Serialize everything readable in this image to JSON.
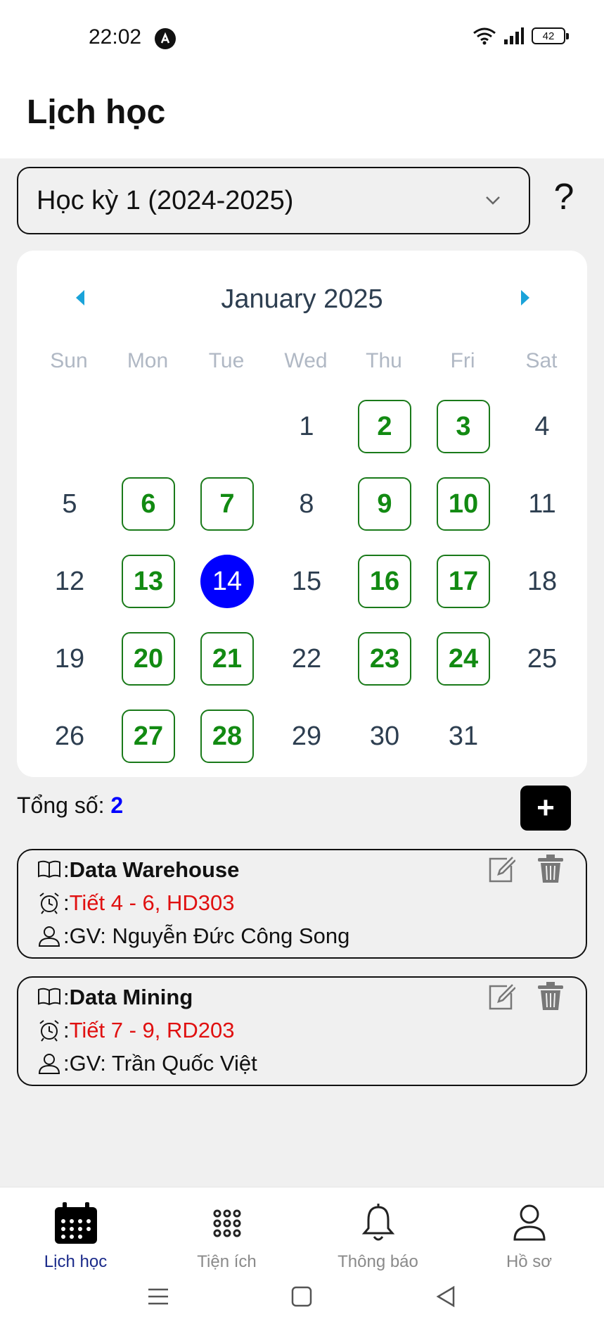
{
  "status_bar": {
    "time": "22:02",
    "battery": "42"
  },
  "header": {
    "title": "Lịch học"
  },
  "semester": {
    "selected": "Học kỳ 1 (2024-2025)",
    "help_label": "?"
  },
  "calendar": {
    "month_label": "January 2025",
    "weekdays": [
      "Sun",
      "Mon",
      "Tue",
      "Wed",
      "Thu",
      "Fri",
      "Sat"
    ],
    "selected_day": 14,
    "days_with_classes": [
      2,
      3,
      6,
      7,
      9,
      10,
      13,
      16,
      17,
      20,
      21,
      23,
      24,
      27,
      28
    ],
    "days": [
      {
        "day": "1",
        "col": 3,
        "row": 0
      },
      {
        "day": "2",
        "col": 4,
        "row": 0
      },
      {
        "day": "3",
        "col": 5,
        "row": 0
      },
      {
        "day": "4",
        "col": 6,
        "row": 0
      },
      {
        "day": "5",
        "col": 0,
        "row": 1
      },
      {
        "day": "6",
        "col": 1,
        "row": 1
      },
      {
        "day": "7",
        "col": 2,
        "row": 1
      },
      {
        "day": "8",
        "col": 3,
        "row": 1
      },
      {
        "day": "9",
        "col": 4,
        "row": 1
      },
      {
        "day": "10",
        "col": 5,
        "row": 1
      },
      {
        "day": "11",
        "col": 6,
        "row": 1
      },
      {
        "day": "12",
        "col": 0,
        "row": 2
      },
      {
        "day": "13",
        "col": 1,
        "row": 2
      },
      {
        "day": "14",
        "col": 2,
        "row": 2
      },
      {
        "day": "15",
        "col": 3,
        "row": 2
      },
      {
        "day": "16",
        "col": 4,
        "row": 2
      },
      {
        "day": "17",
        "col": 5,
        "row": 2
      },
      {
        "day": "18",
        "col": 6,
        "row": 2
      },
      {
        "day": "19",
        "col": 0,
        "row": 3
      },
      {
        "day": "20",
        "col": 1,
        "row": 3
      },
      {
        "day": "21",
        "col": 2,
        "row": 3
      },
      {
        "day": "22",
        "col": 3,
        "row": 3
      },
      {
        "day": "23",
        "col": 4,
        "row": 3
      },
      {
        "day": "24",
        "col": 5,
        "row": 3
      },
      {
        "day": "25",
        "col": 6,
        "row": 3
      },
      {
        "day": "26",
        "col": 0,
        "row": 4
      },
      {
        "day": "27",
        "col": 1,
        "row": 4
      },
      {
        "day": "28",
        "col": 2,
        "row": 4
      },
      {
        "day": "29",
        "col": 3,
        "row": 4
      },
      {
        "day": "30",
        "col": 4,
        "row": 4
      },
      {
        "day": "31",
        "col": 5,
        "row": 4
      }
    ]
  },
  "summary": {
    "total_label": "Tổng số: ",
    "total_count": "2",
    "add_label": "+"
  },
  "classes": [
    {
      "course": "Data Warehouse",
      "time_room": "Tiết 4 - 6, HD303",
      "teacher": "GV: Nguyễn Đức Công Song"
    },
    {
      "course": "Data Mining",
      "time_room": "Tiết 7 - 9, RD203",
      "teacher": "GV: Trần Quốc Việt"
    }
  ],
  "separator": ": ",
  "bottom_nav": [
    {
      "label": "Lịch học",
      "icon": "calendar-icon",
      "active": true
    },
    {
      "label": "Tiện ích",
      "icon": "grid-icon",
      "active": false
    },
    {
      "label": "Thông báo",
      "icon": "bell-icon",
      "active": false
    },
    {
      "label": "Hồ sơ",
      "icon": "user-icon",
      "active": false
    }
  ],
  "colors": {
    "accent": "#0000ff",
    "marked": "#128a12",
    "time_room": "#e01010",
    "nav_active": "#1a2a8a"
  }
}
